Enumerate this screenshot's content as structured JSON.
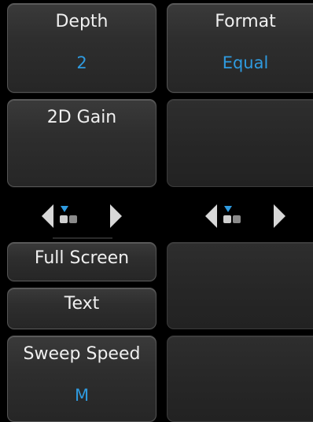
{
  "left_column": {
    "depth": {
      "label": "Depth",
      "value": "2"
    },
    "gain_2d": {
      "label": "2D Gain"
    },
    "full_screen": {
      "label": "Full Screen"
    },
    "text": {
      "label": "Text"
    },
    "sweep_speed": {
      "label": "Sweep Speed",
      "value": "M"
    }
  },
  "right_column": {
    "format": {
      "label": "Format",
      "value": "Equal"
    }
  },
  "pager": {
    "current_page": 1,
    "total_pages": 2
  },
  "colors": {
    "accent": "#2f9be0",
    "button_border": "#555555",
    "background": "#000000"
  },
  "icons": [
    "arrow-left-icon",
    "page-indicator-icon",
    "arrow-right-icon"
  ]
}
